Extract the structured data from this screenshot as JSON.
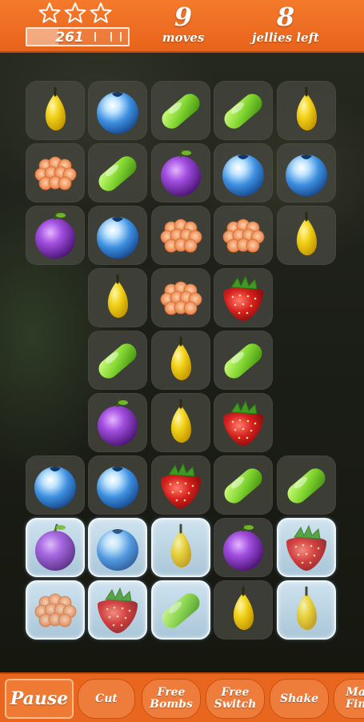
{
  "hud": {
    "score": "261",
    "score_progress": 0.31,
    "stars_earned": 0,
    "moves_value": "9",
    "moves_label": "moves",
    "jellies_value": "8",
    "jellies_label": "jellies left"
  },
  "board": {
    "rows": [
      [
        "banana",
        "blueberry",
        "grape",
        "grape",
        "banana"
      ],
      [
        "raspberry",
        "grape",
        "plum",
        "blueberry",
        "blueberry"
      ],
      [
        "plum",
        "blueberry",
        "raspberry",
        "raspberry",
        "banana"
      ],
      [
        null,
        "banana",
        "raspberry",
        "strawberry",
        null
      ],
      [
        null,
        "grape",
        "banana",
        "grape",
        null
      ],
      [
        null,
        "plum",
        "banana",
        "strawberry",
        null
      ],
      [
        "blueberry",
        "blueberry",
        "strawberry",
        "grape",
        "grape"
      ],
      [
        "plum",
        "blueberry",
        "banana",
        "plum",
        "strawberry"
      ],
      [
        "raspberry",
        "strawberry",
        "grape",
        "banana",
        "banana"
      ]
    ],
    "jelly": [
      [
        false,
        false,
        false,
        false,
        false
      ],
      [
        false,
        false,
        false,
        false,
        false
      ],
      [
        false,
        false,
        false,
        false,
        false
      ],
      [
        false,
        false,
        false,
        false,
        false
      ],
      [
        false,
        false,
        false,
        false,
        false
      ],
      [
        false,
        false,
        false,
        false,
        false
      ],
      [
        false,
        false,
        false,
        false,
        false
      ],
      [
        true,
        true,
        true,
        false,
        true
      ],
      [
        true,
        true,
        true,
        false,
        true
      ]
    ]
  },
  "toolbar": {
    "pause": "Pause",
    "cut": "Cut",
    "free_bombs": "Free\nBombs",
    "free_switch": "Free\nSwitch",
    "shake": "Shake",
    "more": "Ma\nFin"
  },
  "colors": {
    "bar": "#e8661e",
    "banana": "#f2d21a",
    "blueberry": "#3d8fe0",
    "grape": "#84d832",
    "plum": "#7d2fb8",
    "raspberry": "#f4935a",
    "strawberry": "#d8201f"
  }
}
